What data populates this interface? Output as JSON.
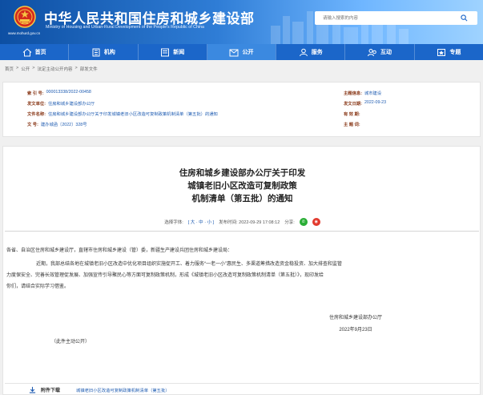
{
  "header": {
    "title_cn": "中华人民共和国住房和城乡建设部",
    "title_en": "Ministry of Housing and Urban-Rural Development of the People's Republic of China",
    "site_url": "www.mohurd.gov.cn",
    "search_placeholder": "请输入搜索的内容",
    "colors": {
      "header_start": "#0d4fa3",
      "header_end": "#9fd3ff",
      "nav": "#1b66c9",
      "nav_active": "#3b89e0"
    }
  },
  "nav": {
    "items": [
      {
        "label": "首页",
        "icon": "home-icon"
      },
      {
        "label": "机构",
        "icon": "building-icon"
      },
      {
        "label": "新闻",
        "icon": "news-icon"
      },
      {
        "label": "公开",
        "icon": "open-icon",
        "active": true
      },
      {
        "label": "服务",
        "icon": "service-icon"
      },
      {
        "label": "互动",
        "icon": "interact-icon"
      },
      {
        "label": "专题",
        "icon": "topic-icon"
      }
    ]
  },
  "breadcrumb": [
    "首页",
    ">",
    "公开",
    ">",
    "法定主动公开内容",
    ">",
    "部发文件"
  ],
  "meta": {
    "index_no_label": "索 引 号:",
    "index_no": "000013338/2022-00458",
    "publisher_label": "发文单位:",
    "publisher": "住房和城乡建设部办公厅",
    "file_name_label": "文件名称:",
    "file_name": "住房和城乡建设部办公厅关于印发城镇老旧小区改造可复制政策机制清单（第五批）的通知",
    "doc_no_label": "文 号:",
    "doc_no": "建办城函〔2022〕328号",
    "category_label": "主题信息:",
    "category": "城市建设",
    "date_label": "发文日期:",
    "date": "2022-09-23",
    "validity_label": "有 效 期:",
    "validity": "",
    "topic_label": "主 题 词:",
    "topic": ""
  },
  "article": {
    "title_lines": [
      "住房和城乡建设部办公厅关于印发",
      "城镇老旧小区改造可复制政策",
      "机制清单（第五批）的通知"
    ],
    "font_label": "选择字体:",
    "font_options": "[ 大 · 中 · 小 ]",
    "publish_time": "发布时间: 2022-09-29 17:08:12",
    "share_label": "分享:",
    "recipients": "各省、自治区住房和城乡建设厅，直辖市住房和城乡建设（管）委，新疆生产建设兵团住房和城乡建设局：",
    "body_line1": "近期，我部总结各地在城镇老旧小区改造中优化项目组织实施促开工、着力服务“一老一小”惠民生、多渠道筹措改造资金稳投资、加大排查和监管",
    "body_line2": "力度保安全、完善长效管理促发展、加强宣传引导聚民心等方面可复制政策机制，形成《城镇老旧小区改造可复制政策机制清单（第五批）》，现印发给",
    "body_line3": "你们，请结合实际学习借鉴。",
    "signer": "住房和城乡建设部办公厅",
    "sign_date": "2022年9月23日",
    "note": "（此件主动公开）",
    "attachment_label": "附件下载",
    "attachment_link": "城镇老旧小区改造可复制政策机制清单（第五批）"
  }
}
